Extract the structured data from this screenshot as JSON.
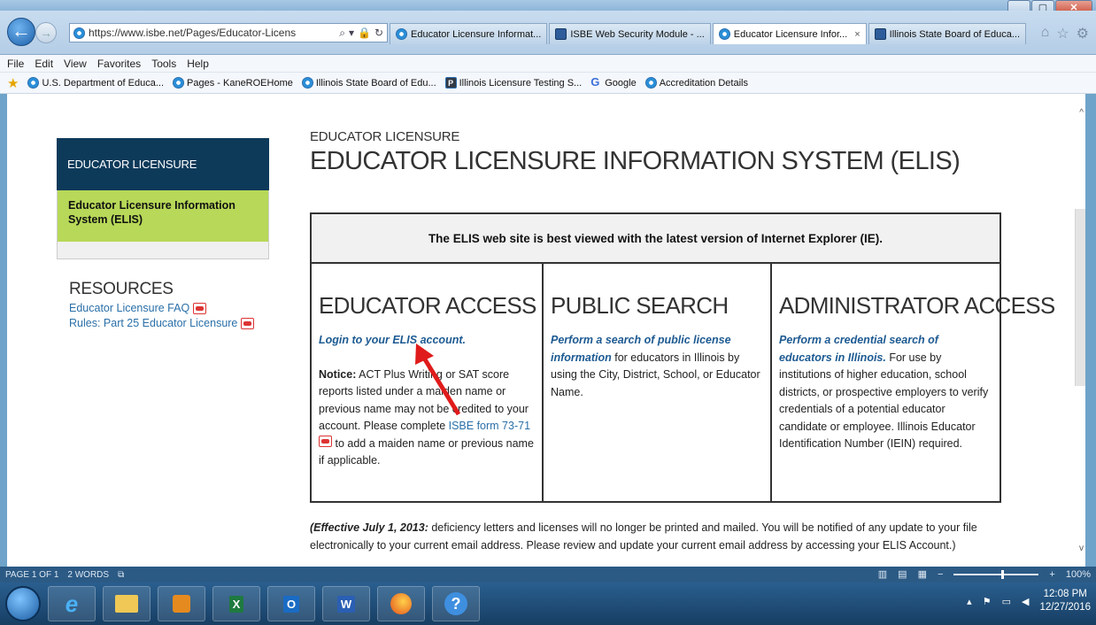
{
  "browser": {
    "address_url": "https://www.isbe.net/Pages/Educator-Licens",
    "tabs": [
      {
        "label": "Educator Licensure Informat...",
        "icon": "ie-icon"
      },
      {
        "label": "ISBE Web Security Module - ...",
        "icon": "isbe-icon"
      },
      {
        "label": "Educator Licensure Infor...",
        "icon": "ie-icon",
        "active": true,
        "close": "×"
      },
      {
        "label": "Illinois State Board of Educa...",
        "icon": "isbe-icon"
      }
    ]
  },
  "menubar": [
    "File",
    "Edit",
    "View",
    "Favorites",
    "Tools",
    "Help"
  ],
  "favorites": [
    {
      "label": "U.S. Department of Educa..."
    },
    {
      "label": "Pages - KaneROEHome"
    },
    {
      "label": "Illinois State Board of Edu..."
    },
    {
      "label": "Illinois Licensure Testing S..."
    },
    {
      "label": "Google"
    },
    {
      "label": "Accreditation Details"
    }
  ],
  "sidebar": {
    "header": "EDUCATOR LICENSURE",
    "active_item": "Educator Licensure Information System (ELIS)",
    "resources_title": "RESOURCES",
    "resources": [
      "Educator Licensure FAQ",
      "Rules: Part 25 Educator Licensure"
    ]
  },
  "main": {
    "subtitle": "EDUCATOR LICENSURE",
    "title": "EDUCATOR LICENSURE INFORMATION SYSTEM (ELIS)",
    "notice": "The ELIS web site is best viewed with the latest version of Internet Explorer (IE).",
    "educator_access": {
      "title": "EDUCATOR ACCESS",
      "link": "Login to your ELIS account.",
      "notice_label": "Notice:",
      "notice_text": " ACT Plus Writing or SAT score reports listed under a maiden name or previous name may not be credited to your account.  Please complete ",
      "form_link": "ISBE form 73-71",
      "notice_end": "  to add a maiden name or previous name if applicable."
    },
    "public_search": {
      "title": "PUBLIC SEARCH",
      "link": "Perform a search of public license information",
      "text": " for educators in Illinois by using the City, District, School, or Educator Name."
    },
    "administrator_access": {
      "title": "ADMINISTRATOR ACCESS",
      "link": "Perform a credential search of educators in Illinois.",
      "text": " For use by institutions of higher education, school districts, or prospective employers to verify credentials of a potential educator candidate or employee. Illinois Educator Identification Number (IEIN) required."
    },
    "footer_lead": "(Effective July 1, 2013:",
    "footer_text": " deficiency letters and licenses will no longer be printed and mailed.  You will be notified of any update to your file electronically to your current email address.  Please review and update your current email address by accessing your ELIS Account.)"
  },
  "statusbar": {
    "page": "PAGE 1 OF 1",
    "words": "2 WORDS",
    "zoom_minus": "−",
    "zoom_plus": "+",
    "zoom": "100%"
  },
  "taskbar": {
    "time": "12:08 PM",
    "date": "12/27/2016",
    "excel": "X",
    "outlook": "O",
    "word": "W",
    "help": "?"
  },
  "colors": {
    "nav_header": "#0e3a5a",
    "nav_active": "#b7d858",
    "link": "#2a6fa8",
    "arrow": "#e01b1b"
  }
}
